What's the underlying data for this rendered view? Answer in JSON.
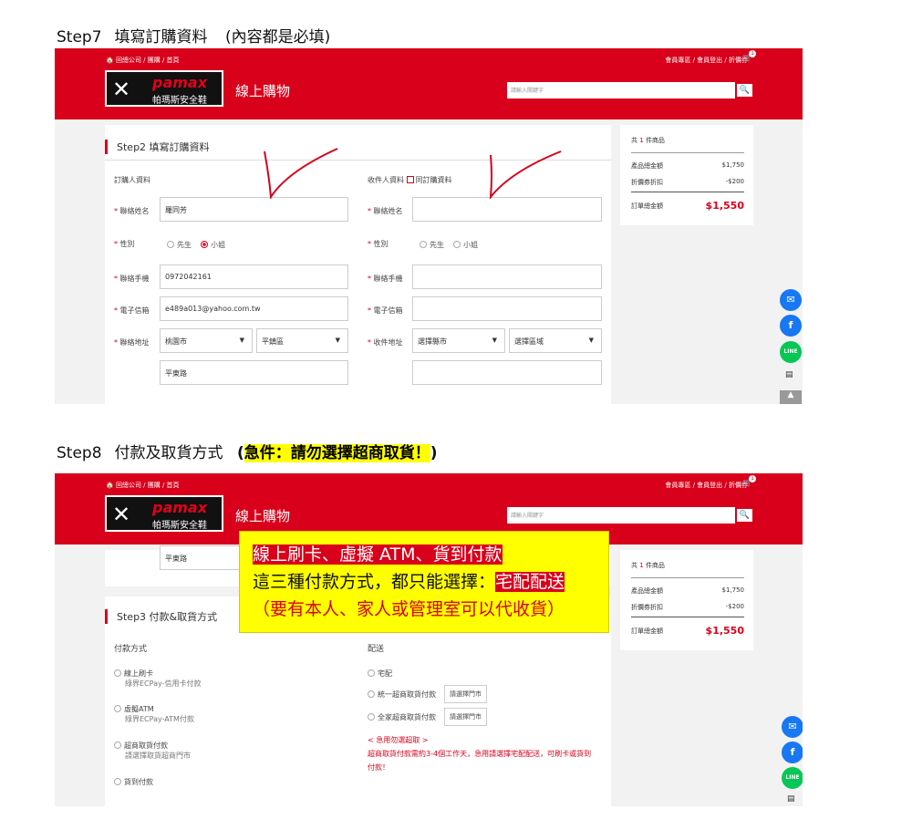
{
  "step7": {
    "title": "Step7",
    "sub": "填寫訂購資料",
    "note": "(內容都是必填)"
  },
  "step8": {
    "title": "Step8",
    "sub": "付款及取貨方式",
    "note_pre": "(",
    "note": "急件：請勿選擇超商取貨！",
    "note_post": ")"
  },
  "header": {
    "breadcrumb": "🏠 回總公司 / 團購 / 首頁",
    "links": "會員專區 / 會員登出 / 折價券",
    "cart_count": "1",
    "brand": "pamax",
    "brand_zh": "帕瑪斯安全鞋",
    "shop_title": "線上購物",
    "search_placeholder": "請輸入關鍵字"
  },
  "form": {
    "title": "Step2 填寫訂購資料",
    "buyer": "訂購人資料",
    "receiver": "收件人資料",
    "same": "同訂購資料",
    "name_lbl": "聯絡姓名",
    "gender_lbl": "性別",
    "phone_lbl": "聯絡手機",
    "email_lbl": "電子信箱",
    "addr_lbl": "聯絡地址",
    "raddr_lbl": "收件地址",
    "name": "羅同芳",
    "mr": "先生",
    "ms": "小姐",
    "phone": "0972042161",
    "email": "e489a013@yahoo.com.tw",
    "city": "桃園市",
    "district": "平鎮區",
    "street": "平東路",
    "rcity": "選擇縣市",
    "rdistrict": "選擇區域"
  },
  "summary": {
    "count_pre": "共",
    "count": "1",
    "count_post": "件商品",
    "subtotal_lbl": "產品總金額",
    "subtotal": "$1,750",
    "discount_lbl": "折價券折扣",
    "discount": "-$200",
    "total_lbl": "訂單總金額",
    "total": "$1,550"
  },
  "step3": {
    "title": "Step3 付款&取貨方式",
    "pay_title": "付款方式",
    "ship_title": "配送",
    "p1": "線上刷卡",
    "p1s": "綠界ECPay-信用卡付款",
    "p2": "虛擬ATM",
    "p2s": "綠界ECPay-ATM付款",
    "p3": "超商取貨付款",
    "p3s": "請選擇取貨超商門市",
    "p4": "貨到付款",
    "s1": "宅配",
    "s2": "統一超商取貨付款",
    "s3": "全家超商取貨付款",
    "store_btn": "請選擇門市",
    "urgent_title": "< 急用勿選超取 >",
    "urgent_1": "超商取貨付款需約3-4個工作天，急用請選擇宅配配送，可刷卡或貨到",
    "urgent_2": "付款！"
  },
  "note": {
    "l1": "線上刷卡、虛擬 ATM、貨到付款",
    "l2a": "這三種付款方式，都只能選擇：",
    "l2b": "宅配配送",
    "l3": "（要有本人、家人或管理室可以代收貨）"
  },
  "colors": {
    "brand_red": "#d8001a",
    "highlight": "#ffff00"
  },
  "icons": [
    "messenger-icon",
    "facebook-icon",
    "line-icon",
    "doc-icon"
  ]
}
